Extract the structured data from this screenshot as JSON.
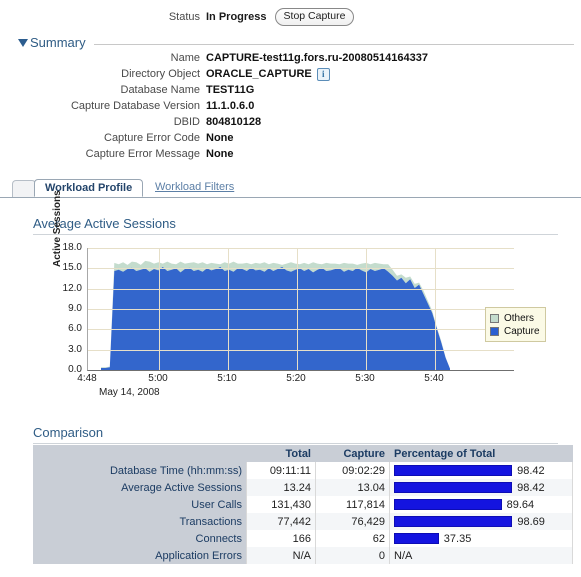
{
  "status": {
    "label": "Status",
    "value": "In Progress",
    "button": "Stop Capture"
  },
  "summary": {
    "title": "Summary",
    "triangle_icon": "disclosure-triangle-down-icon",
    "properties": [
      {
        "label": "Name",
        "value": "CAPTURE-test11g.fors.ru-20080514164337"
      },
      {
        "label": "Directory Object",
        "value": "ORACLE_CAPTURE",
        "info_icon": "i"
      },
      {
        "label": "Database Name",
        "value": "TEST11G"
      },
      {
        "label": "Capture Database Version",
        "value": "11.1.0.6.0"
      },
      {
        "label": "DBID",
        "value": "804810128"
      },
      {
        "label": "Capture Error Code",
        "value": "None"
      },
      {
        "label": "Capture Error Message",
        "value": "None"
      }
    ]
  },
  "tabs": [
    {
      "label": "Workload Profile",
      "active": true
    },
    {
      "label": "Workload Filters",
      "active": false
    }
  ],
  "chart_section": {
    "title": "Average Active Sessions"
  },
  "chart_data": {
    "type": "area",
    "title": "Average Active Sessions",
    "xlabel": "",
    "ylabel": "Active Sessions",
    "date_label": "May 14, 2008",
    "ylim": [
      0.0,
      18.0
    ],
    "y_ticks": [
      "18.0",
      "15.0",
      "12.0",
      "9.0",
      "6.0",
      "3.0",
      "0.0"
    ],
    "y_tick_values": [
      18.0,
      15.0,
      12.0,
      9.0,
      6.0,
      3.0,
      0.0
    ],
    "x_ticks": [
      "4:48",
      "5:00",
      "5:10",
      "5:20",
      "5:30",
      "5:40"
    ],
    "grid": true,
    "legend_position": "right",
    "series": [
      {
        "name": "Capture",
        "color": "#3366cc",
        "values": [
          0.3,
          0.3,
          0.4,
          14.6,
          14.8,
          14.5,
          14.9,
          15.1,
          14.6,
          14.8,
          15.0,
          14.5,
          14.9,
          14.7,
          15.2,
          14.6,
          14.8,
          15.0,
          14.4,
          14.9,
          15.1,
          14.6,
          14.8,
          14.5,
          15.0,
          14.7,
          14.9,
          15.2,
          14.6,
          14.8,
          14.5,
          15.0,
          14.9,
          14.6,
          15.1,
          14.7,
          14.8,
          14.5,
          15.0,
          14.6,
          14.9,
          15.2,
          14.7,
          14.5,
          14.8,
          15.0,
          14.6,
          14.9,
          14.4,
          14.8,
          15.1,
          14.6,
          14.7,
          14.9,
          15.0,
          14.5,
          14.8,
          14.6,
          15.1,
          14.7,
          14.4,
          14.9,
          14.6,
          14.8,
          15.0,
          14.5,
          13.9,
          13.2,
          13.6,
          12.8,
          13.4,
          12.1,
          12.6,
          11.2,
          9.8,
          8.4,
          6.2,
          4.1,
          1.8,
          0.2
        ]
      },
      {
        "name": "Others",
        "color": "#c4dccd",
        "values": [
          0.1,
          0.1,
          0.1,
          1.2,
          0.8,
          1.4,
          0.6,
          0.9,
          1.3,
          0.7,
          1.1,
          1.5,
          0.8,
          1.2,
          0.5,
          1.4,
          0.9,
          0.6,
          1.6,
          0.8,
          0.7,
          1.3,
          0.9,
          1.4,
          0.6,
          1.1,
          0.8,
          0.4,
          1.3,
          0.9,
          1.5,
          0.7,
          0.8,
          1.2,
          0.5,
          1.1,
          0.9,
          1.4,
          0.6,
          1.2,
          0.8,
          0.3,
          1.0,
          1.4,
          0.9,
          0.6,
          1.2,
          0.7,
          1.5,
          0.9,
          0.5,
          1.2,
          1.0,
          0.8,
          0.6,
          1.3,
          0.9,
          1.1,
          0.4,
          1.0,
          1.4,
          0.7,
          1.2,
          0.9,
          0.6,
          1.1,
          0.9,
          0.7,
          0.5,
          0.8,
          0.4,
          0.6,
          0.3,
          0.5,
          0.4,
          0.3,
          0.2,
          0.2,
          0.1,
          0.0
        ]
      }
    ],
    "legend": [
      {
        "name": "Others",
        "color": "#c4dccd"
      },
      {
        "name": "Capture",
        "color": "#2b5fd0"
      }
    ]
  },
  "comparison": {
    "title": "Comparison",
    "columns": [
      "",
      "Total",
      "Capture",
      "Percentage of Total"
    ],
    "rows": [
      {
        "label": "Database Time (hh:mm:ss)",
        "total": "09:11:11",
        "capture": "09:02:29",
        "percent": "98.42",
        "percent_value": 98.42
      },
      {
        "label": "Average Active Sessions",
        "total": "13.24",
        "capture": "13.04",
        "percent": "98.42",
        "percent_value": 98.42
      },
      {
        "label": "User Calls",
        "total": "131,430",
        "capture": "117,814",
        "percent": "89.64",
        "percent_value": 89.64
      },
      {
        "label": "Transactions",
        "total": "77,442",
        "capture": "76,429",
        "percent": "98.69",
        "percent_value": 98.69
      },
      {
        "label": "Connects",
        "total": "166",
        "capture": "62",
        "percent": "37.35",
        "percent_value": 37.35
      },
      {
        "label": "Application Errors",
        "total": "N/A",
        "capture": "0",
        "percent": "N/A",
        "percent_value": null
      }
    ]
  },
  "colors": {
    "section_title": "#2f5c85",
    "table_header_bg": "#c9ced6",
    "bar": "#1414e0",
    "capture_series": "#3366cc",
    "others_series": "#c4dccd"
  }
}
